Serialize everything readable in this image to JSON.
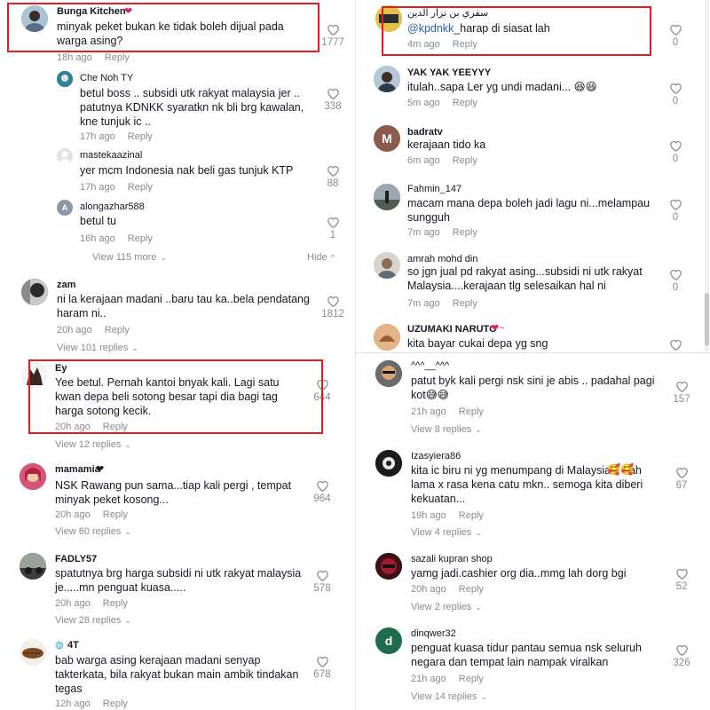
{
  "left": {
    "c1": {
      "user": "Bunga Kitchen",
      "text": "minyak peket bukan ke tidak boleh dijual pada warga asing?",
      "time": "18h ago",
      "reply": "Reply",
      "likes": "1777"
    },
    "r1": {
      "user": "Che Noh TY",
      "text": "betul boss .. subsidi utk rakyat malaysia jer .. patutnya KDNKK syaratkn nk bli brg kawalan, kne tunjuk ic ..",
      "time": "17h ago",
      "reply": "Reply",
      "likes": "338"
    },
    "r2": {
      "user": "mastekaazinal",
      "text": "yer mcm Indonesia nak beli gas tunjuk KTP",
      "time": "17h ago",
      "reply": "Reply",
      "likes": "88"
    },
    "r3": {
      "user": "alongazhar588",
      "avatar_letter": "A",
      "text": "betul tu",
      "time": "16h ago",
      "reply": "Reply",
      "likes": "1"
    },
    "view_more": "View 115 more",
    "hide": "Hide",
    "c2": {
      "user": "zam",
      "text": "ni la kerajaan madani ..baru tau ka..bela pendatang haram ni..",
      "time": "20h ago",
      "reply": "Reply",
      "likes": "1812",
      "view": "View 101 replies"
    },
    "c3": {
      "user": "Ey",
      "text": "Yee betul. Pernah kantoi bnyak kali. Lagi satu kwan depa beli sotong besar tapi dia bagi tag harga sotong kecik.",
      "time": "20h ago",
      "reply": "Reply",
      "likes": "644",
      "view": "View 12 replies"
    },
    "c4": {
      "user": "mamamia",
      "text": "NSK Rawang pun sama...tiap kali pergi , tempat minyak peket kosong...",
      "time": "20h ago",
      "reply": "Reply",
      "likes": "964",
      "view": "View 60 replies"
    },
    "c5": {
      "user": "FADLY57",
      "text": "spatutnya brg harga subsidi ni utk rakyat malaysia je.....mn penguat kuasa.....",
      "time": "20h ago",
      "reply": "Reply",
      "likes": "578",
      "view": "View 28 replies"
    },
    "c6": {
      "user": "4T",
      "text": "bab warga asing kerajaan madani senyap takterkata, bila rakyat bukan main ambik tindakan tegas",
      "time": "12h ago",
      "reply": "Reply",
      "likes": "678"
    }
  },
  "right": {
    "r0": {
      "user": "سفري بن نزار الدين",
      "mention": "@kpdnkk",
      "text": "_harap di siasat lah",
      "time": "4m ago",
      "reply": "Reply",
      "likes": "0"
    },
    "r1": {
      "user": "YAK YAK YEEYYY",
      "text": "itulah..sapa Ler yg undi madani...",
      "time": "5m ago",
      "reply": "Reply",
      "likes": "0"
    },
    "r2": {
      "user": "badratv",
      "avatar_letter": "M",
      "text": "kerajaan tido ka",
      "time": "6m ago",
      "reply": "Reply",
      "likes": "0"
    },
    "r3": {
      "user": "Fahmin_147",
      "text": "macam mana depa boleh jadi lagu ni...melampau sungguh",
      "time": "7m ago",
      "reply": "Reply",
      "likes": "0"
    },
    "r4": {
      "user": "amrah mohd din",
      "text": "so jgn jual pd rakyat asing...subsidi ni utk rakyat Malaysia....kerajaan tlg selesaikan hal ni",
      "time": "7m ago",
      "reply": "Reply",
      "likes": "0"
    },
    "r5": {
      "user": "UZUMAKI NARUTO",
      "text": "kita bayar cukai depa yg sng"
    },
    "c1": {
      "user": "^^^__^^^",
      "text": "patut byk kali pergi nsk sini je abis .. padahal pagi kot",
      "time": "21h ago",
      "reply": "Reply",
      "likes": "157",
      "view": "View 8 replies"
    },
    "c2": {
      "user": "Izasyiera86",
      "text": "kita ic biru ni yg menumpang di Malaysia .. dah lama x rasa kena catu mkn.. semoga kita diberi kekuatan...",
      "time": "19h ago",
      "reply": "Reply",
      "likes": "67",
      "view": "View 4 replies"
    },
    "c3": {
      "user": "sazali kupran shop",
      "text": "yamg jadi.cashier org dia..mmg lah dorg bgi",
      "time": "20h ago",
      "reply": "Reply",
      "likes": "52",
      "view": "View 2 replies"
    },
    "c4": {
      "user": "dinqwer32",
      "avatar_letter": "d",
      "text": "penguat kuasa tidur pantau semua nsk seluruh negara dan tempat lain nampak viralkan",
      "time": "21h ago",
      "reply": "Reply",
      "likes": "326",
      "view": "View 14 replies"
    }
  },
  "colors": {
    "highlight_box": "#e11b22",
    "muted": "#8a8b91",
    "mention": "#2b5db3"
  }
}
